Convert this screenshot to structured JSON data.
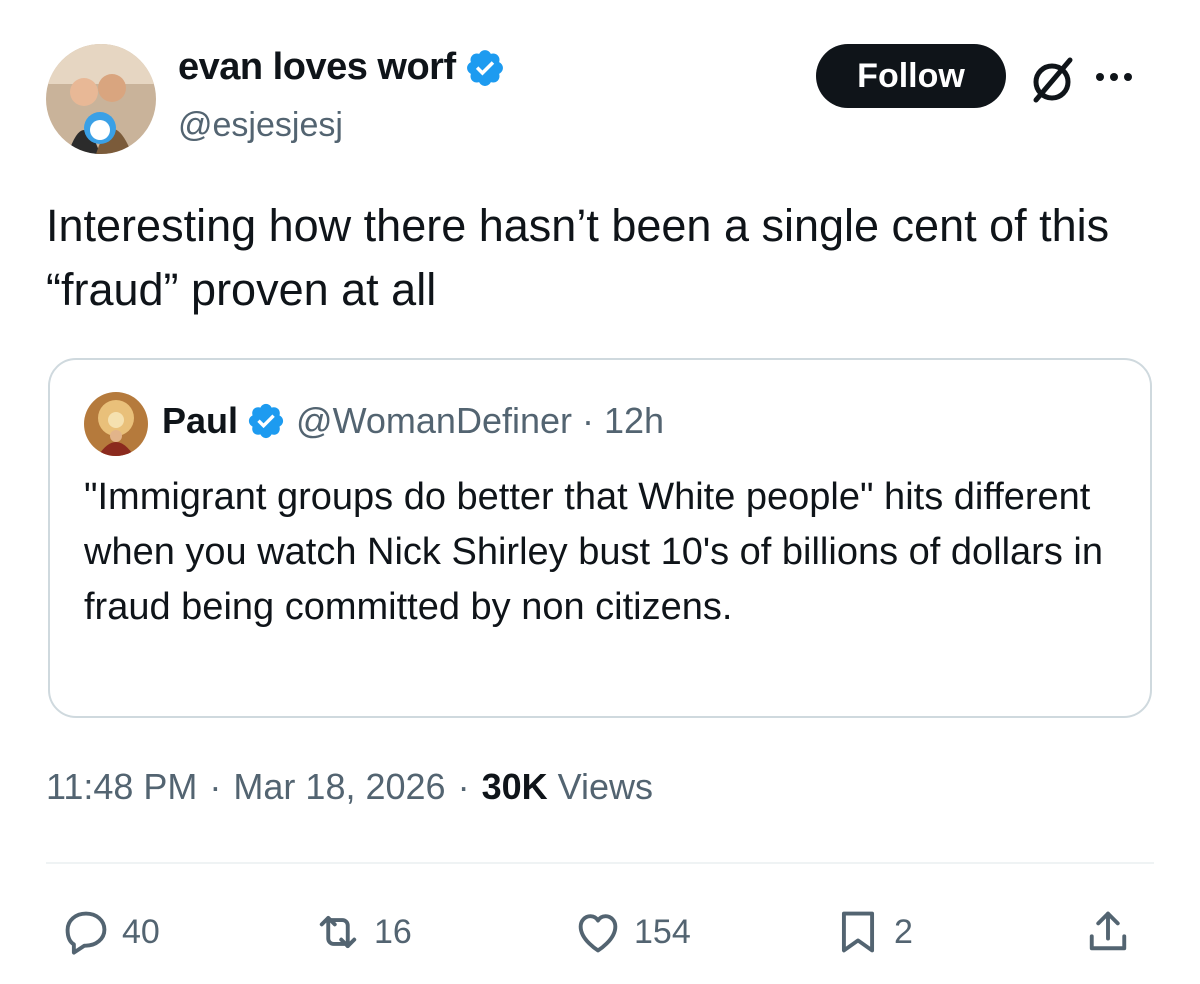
{
  "author": {
    "display_name": "evan loves worf",
    "handle": "@esjesjesj"
  },
  "header": {
    "follow_label": "Follow"
  },
  "tweet": {
    "text": "Interesting how there hasn’t been a single cent of this “fraud” proven at all"
  },
  "quote": {
    "display_name": "Paul",
    "handle": "@WomanDefiner",
    "separator": "·",
    "time": "12h",
    "text": "\"Immigrant groups do better that White people\" hits different when you watch Nick Shirley bust 10's of billions of dollars in fraud being committed by non citizens."
  },
  "meta": {
    "time": "11:48 PM",
    "date": "Mar 18, 2026",
    "separator": "·",
    "views_count": "30K",
    "views_label": "Views"
  },
  "actions": {
    "replies": "40",
    "reposts": "16",
    "likes": "154",
    "bookmarks": "2"
  },
  "colors": {
    "verified": "#1d9bf0",
    "text_primary": "#0f1419",
    "text_secondary": "#536471",
    "border": "#cfd9de"
  },
  "icons": [
    "verified-badge-icon",
    "grok-icon",
    "more-icon",
    "reply-icon",
    "repost-icon",
    "like-icon",
    "bookmark-icon",
    "share-icon"
  ]
}
